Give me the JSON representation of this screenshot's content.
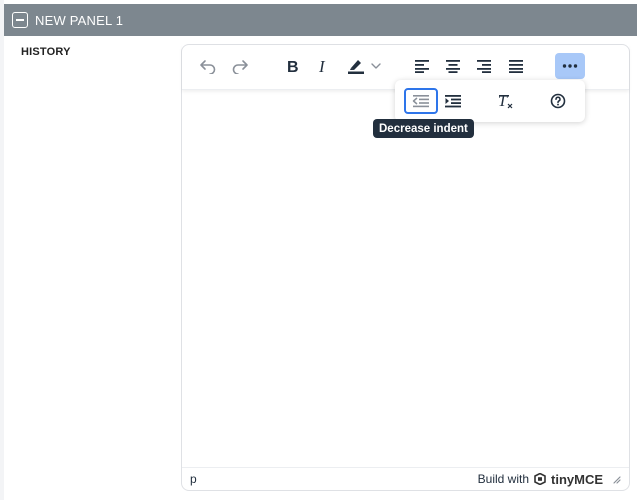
{
  "panel": {
    "title": "NEW PANEL 1",
    "collapse_icon": "minus-square-icon"
  },
  "field": {
    "label": "HISTORY"
  },
  "editor": {
    "toolbar": {
      "buttons": [
        "undo-icon",
        "redo-icon",
        "bold-icon",
        "italic-icon",
        "highlight-color-icon",
        "chevron-down-icon",
        "align-left-icon",
        "align-center-icon",
        "align-right-icon",
        "justify-icon",
        "more-icon"
      ]
    },
    "overflow": {
      "buttons": [
        "outdent-icon",
        "indent-icon",
        "remove-format-icon",
        "help-icon"
      ]
    },
    "status": {
      "path": "p",
      "build_text": "Build with",
      "brand": "tinyMCE"
    }
  },
  "tooltip": {
    "text": "Decrease indent"
  },
  "colors": {
    "header_bg": "#7d878f",
    "active_btn": "#a8c8f8",
    "focus_ring": "#2e75ea",
    "tooltip_bg": "#222f3e"
  }
}
